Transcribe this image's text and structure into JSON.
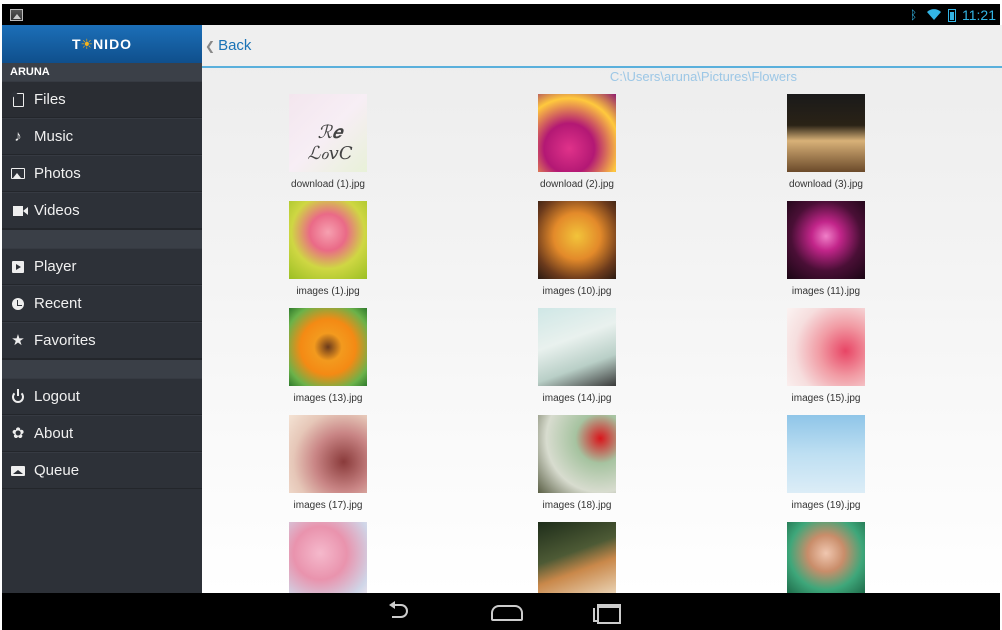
{
  "status_bar": {
    "time": "11:21",
    "bluetooth_icon": "bluetooth-icon",
    "wifi_icon": "wifi-icon",
    "battery_icon": "battery-icon"
  },
  "brand": {
    "logo_text_left": "T",
    "logo_sun": "☀",
    "logo_text_right": "NIDO"
  },
  "sidebar": {
    "user": "ARUNA",
    "items": [
      {
        "label": "Files",
        "icon": "file-icon"
      },
      {
        "label": "Music",
        "icon": "music-note-icon"
      },
      {
        "label": "Photos",
        "icon": "photo-icon"
      },
      {
        "label": "Videos",
        "icon": "video-camera-icon"
      },
      {
        "label": "Player",
        "icon": "player-icon"
      },
      {
        "label": "Recent",
        "icon": "clock-icon"
      },
      {
        "label": "Favorites",
        "icon": "star-icon"
      },
      {
        "label": "Logout",
        "icon": "power-icon"
      },
      {
        "label": "About",
        "icon": "gear-icon"
      },
      {
        "label": "Queue",
        "icon": "queue-icon"
      }
    ]
  },
  "main": {
    "back_label": "Back",
    "path": "C:\\Users\\aruna\\Pictures\\Flowers",
    "files": [
      "download (1).jpg",
      "download (2).jpg",
      "download (3).jpg",
      "images (1).jpg",
      "images (10).jpg",
      "images (11).jpg",
      "images (13).jpg",
      "images (14).jpg",
      "images (15).jpg",
      "images (17).jpg",
      "images (18).jpg",
      "images (19).jpg",
      "",
      "",
      ""
    ],
    "thumb0_text": "ℛ𝒆 ℒℴvC"
  },
  "nav_bar": {
    "back_icon": "back-icon",
    "home_icon": "home-icon",
    "recents_icon": "recents-icon"
  },
  "colors": {
    "accent": "#1a73b6",
    "sidebar_bg": "#2d3138",
    "brand_blue": "#1c6fb8",
    "path_text": "#9cc7e6"
  }
}
